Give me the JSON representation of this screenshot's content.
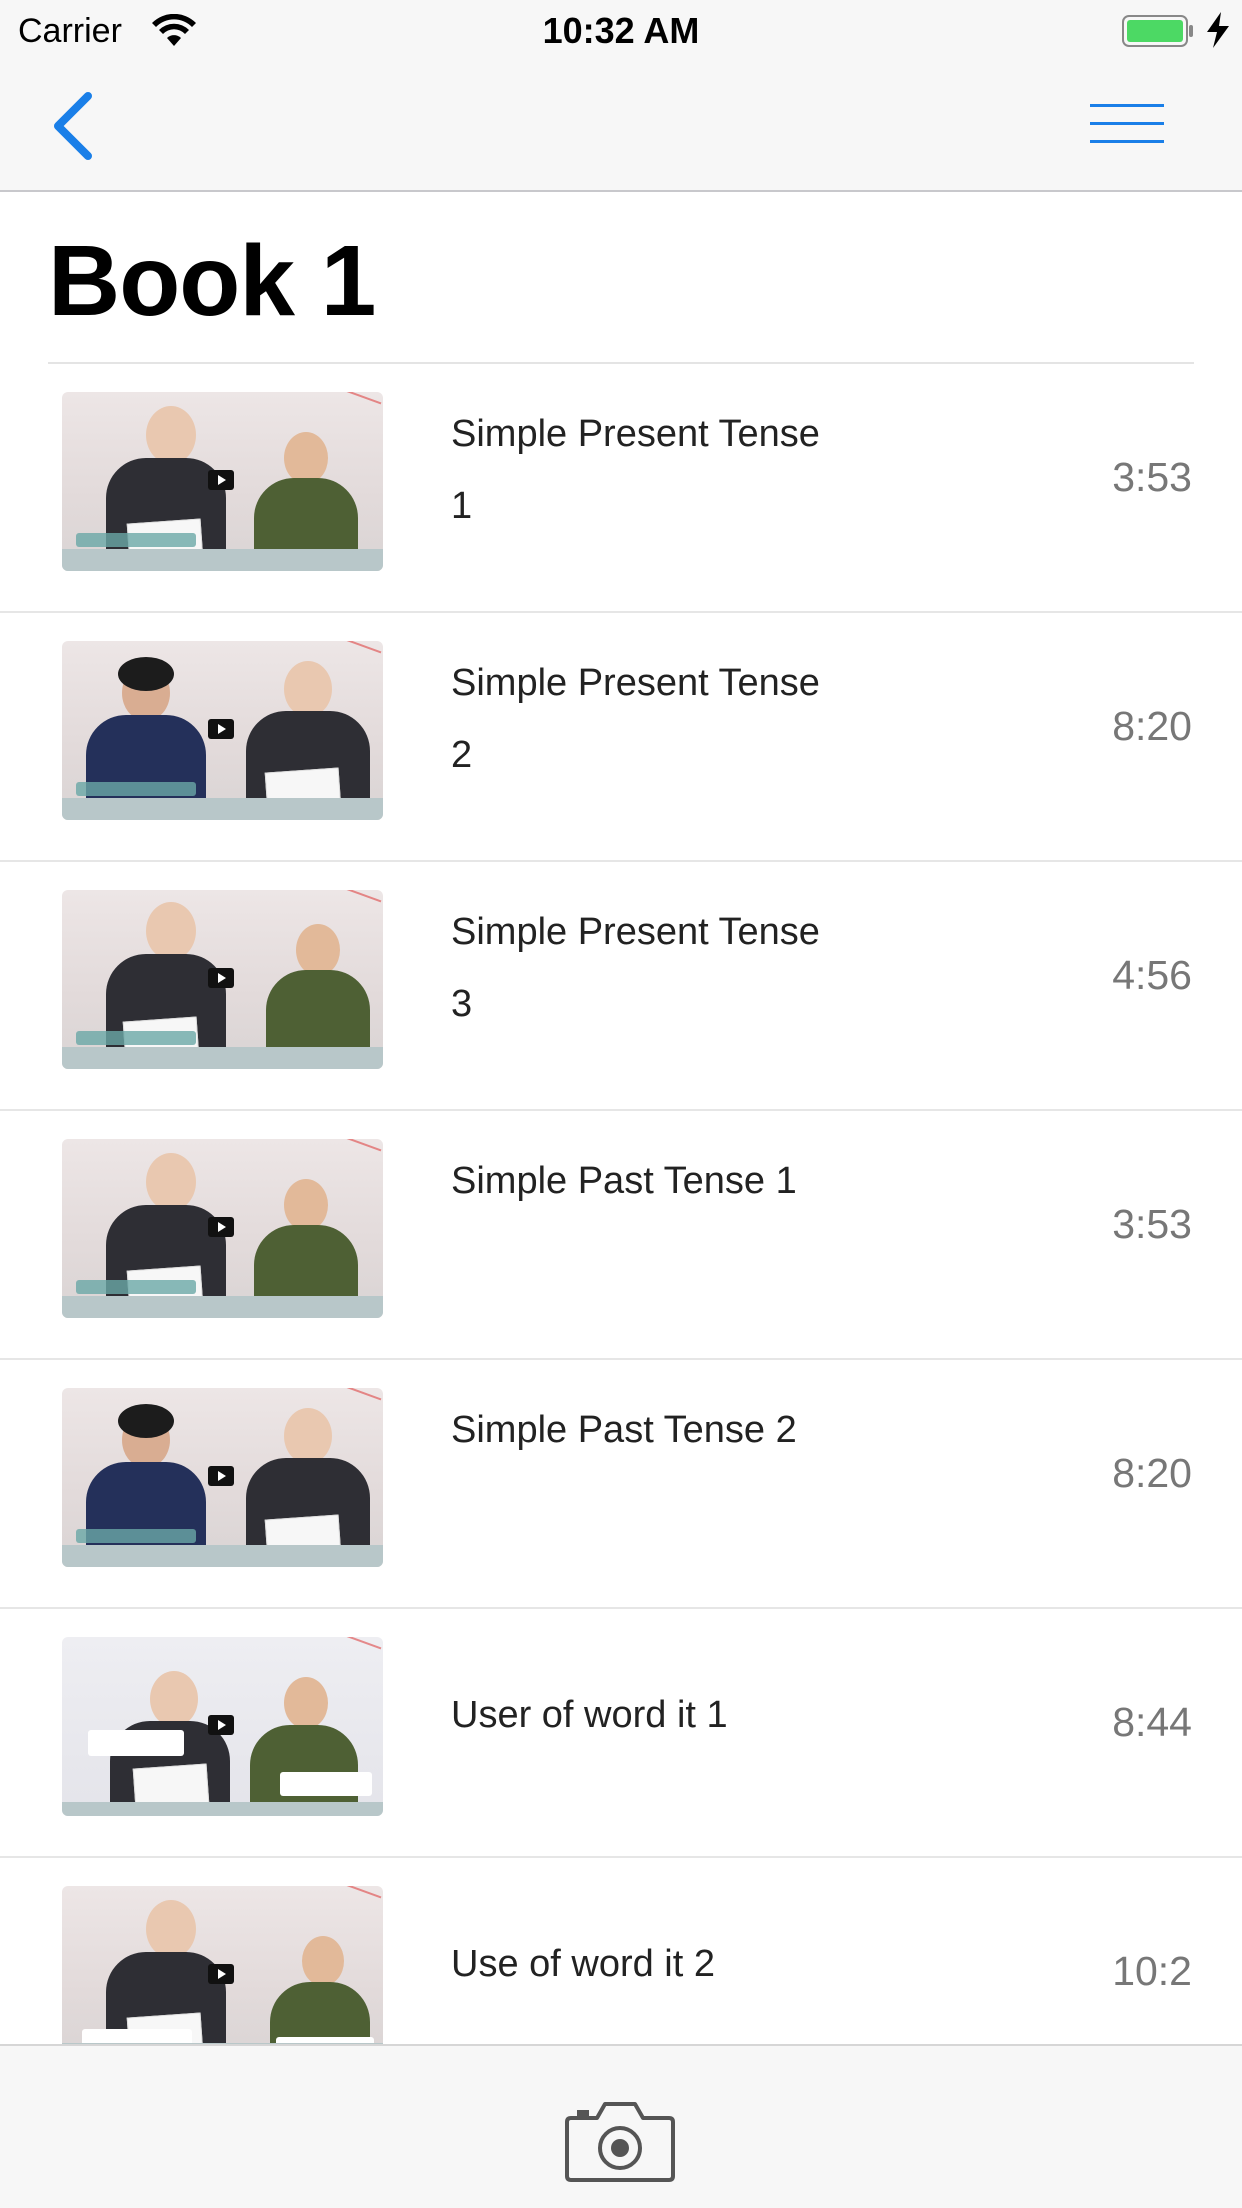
{
  "status_bar": {
    "carrier": "Carrier",
    "time": "10:32 AM"
  },
  "nav": {
    "back_icon": "chevron-left-icon",
    "menu_icon": "hamburger-menu-icon",
    "accent": "#1a7fe8"
  },
  "page": {
    "title": "Book 1"
  },
  "lessons": [
    {
      "title": "Simple Present Tense 1",
      "duration": "3:53"
    },
    {
      "title": "Simple Present Tense 2",
      "duration": "8:20"
    },
    {
      "title": "Simple Present Tense 3",
      "duration": "4:56"
    },
    {
      "title": "Simple Past Tense 1",
      "duration": "3:53"
    },
    {
      "title": "Simple Past Tense 2",
      "duration": "8:20"
    },
    {
      "title": "User of word it 1",
      "duration": "8:44"
    },
    {
      "title": "Use of word it 2",
      "duration": "10:2"
    }
  ],
  "toolbar": {
    "camera_icon": "camera-icon"
  }
}
